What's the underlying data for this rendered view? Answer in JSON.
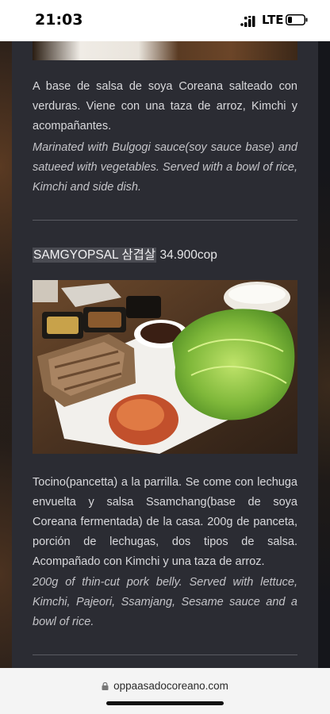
{
  "status_bar": {
    "time": "21:03",
    "network": "LTE"
  },
  "previous_item": {
    "description_es": "A base de salsa de soya Coreana salteado con verduras. Viene con una taza de arroz, Kimchi y acompañantes.",
    "description_en": "Marinated with Bulgogi sauce(soy sauce base) and satueed with vegetables. Served with a bowl of rice, Kimchi and side dish."
  },
  "menu_item": {
    "name": "SAMGYOPSAL 삼겹살",
    "price": "34.900cop",
    "description_es": "Tocino(pancetta) a la parrilla. Se come con lechuga envuelta y salsa Ssamchang(base de soya Coreana fermentada) de la casa. 200g de panceta, porción de lechugas, dos tipos de salsa. Acompañado con Kimchi y una taza de arroz.",
    "description_en": "200g of thin-cut pork belly. Served with lettuce, Kimchi, Pajeori, Ssamjang, Sesame sauce and a bowl of rice."
  },
  "browser": {
    "url": "oppaasadocoreano.com"
  },
  "icons": {
    "lock": "lock-icon",
    "signal": "signal-icon",
    "battery": "battery-icon"
  }
}
